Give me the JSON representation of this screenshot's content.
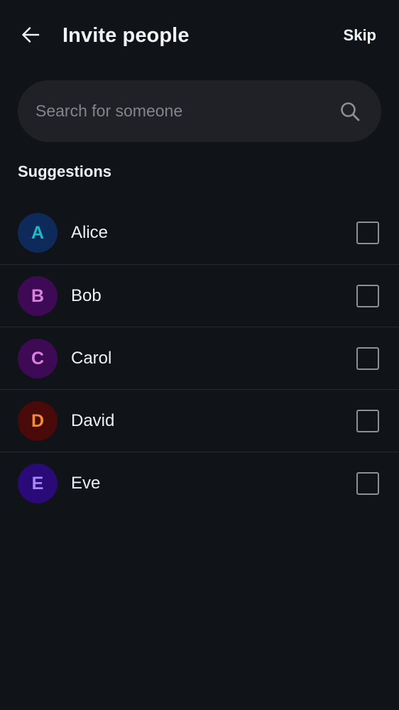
{
  "header": {
    "title": "Invite people",
    "skip_label": "Skip",
    "back_icon": "arrow-left-icon"
  },
  "search": {
    "placeholder": "Search for someone",
    "value": "",
    "icon": "search-icon"
  },
  "suggestions": {
    "label": "Suggestions",
    "items": [
      {
        "initial": "A",
        "name": "Alice",
        "checked": false,
        "avatar_bg": "#0e2a5a",
        "avatar_fg": "#1fb8c9"
      },
      {
        "initial": "B",
        "name": "Bob",
        "checked": false,
        "avatar_bg": "#3f0a55",
        "avatar_fg": "#d782e0"
      },
      {
        "initial": "C",
        "name": "Carol",
        "checked": false,
        "avatar_bg": "#3f0a55",
        "avatar_fg": "#d782e0"
      },
      {
        "initial": "D",
        "name": "David",
        "checked": false,
        "avatar_bg": "#4a0a0a",
        "avatar_fg": "#f08a3c"
      },
      {
        "initial": "E",
        "name": "Eve",
        "checked": false,
        "avatar_bg": "#2a0a78",
        "avatar_fg": "#a987f2"
      }
    ]
  }
}
